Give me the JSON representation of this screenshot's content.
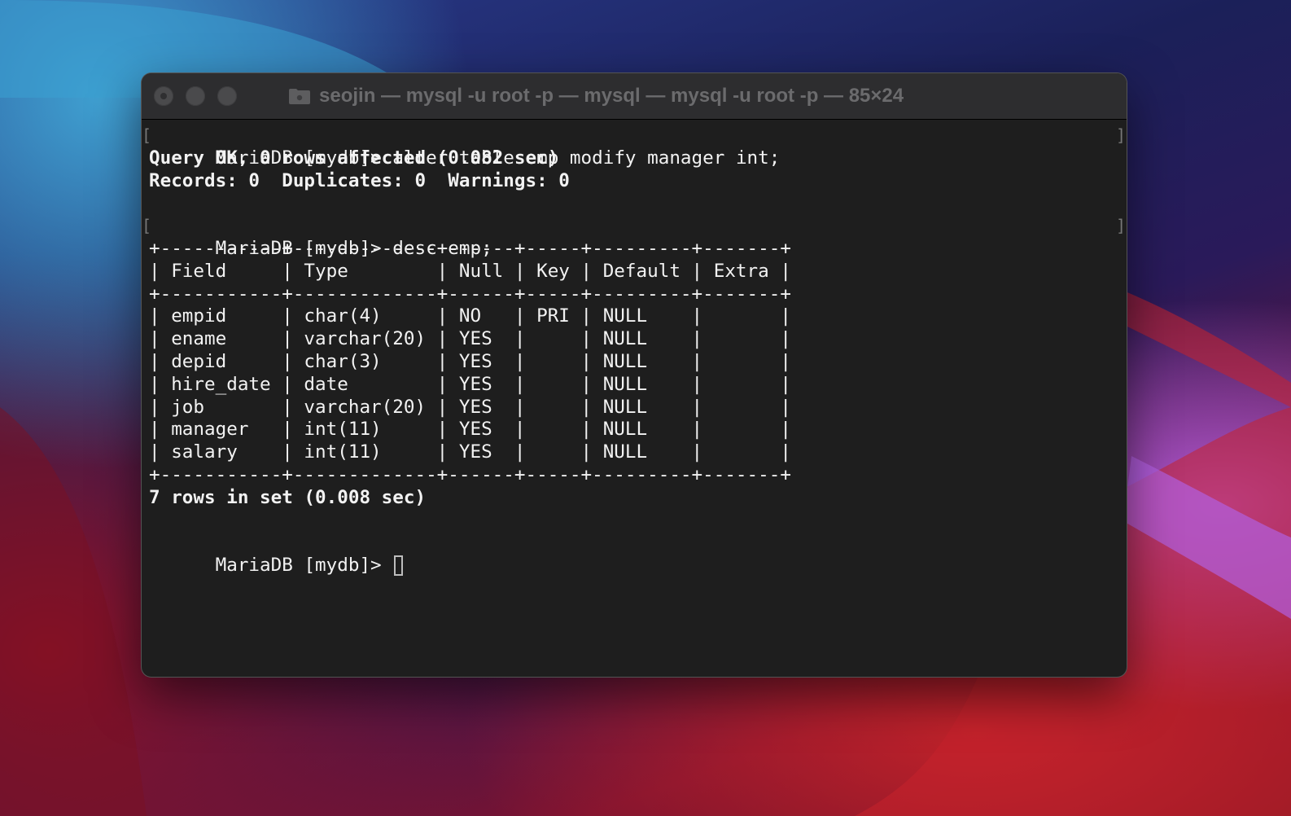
{
  "window": {
    "title": "seojin — mysql -u root -p — mysql — mysql -u root -p — 85×24"
  },
  "terminal": {
    "lines": [
      "MariaDB [mydb]> alter table emp modify manager int;",
      "Query OK, 0 rows affected (0.082 sec)",
      "Records: 0  Duplicates: 0  Warnings: 0",
      "",
      "MariaDB [mydb]> desc emp;",
      "+-----------+-------------+------+-----+---------+-------+",
      "| Field     | Type        | Null | Key | Default | Extra |",
      "+-----------+-------------+------+-----+---------+-------+",
      "| empid     | char(4)     | NO   | PRI | NULL    |       |",
      "| ename     | varchar(20) | YES  |     | NULL    |       |",
      "| depid     | char(3)     | YES  |     | NULL    |       |",
      "| hire_date | date        | YES  |     | NULL    |       |",
      "| job       | varchar(20) | YES  |     | NULL    |       |",
      "| manager   | int(11)     | YES  |     | NULL    |       |",
      "| salary    | int(11)     | YES  |     | NULL    |       |",
      "+-----------+-------------+------+-----+---------+-------+",
      "7 rows in set (0.008 sec)",
      "",
      "MariaDB [mydb]> "
    ],
    "mark_left": "[",
    "mark_right": "]"
  },
  "colors": {
    "terminal_background": "#1e1e1e",
    "terminal_text": "#f2f2f2",
    "titlebar": "#2d2d2f"
  },
  "icons": [
    "folder-icon",
    "close-button",
    "minimize-button",
    "zoom-button"
  ]
}
